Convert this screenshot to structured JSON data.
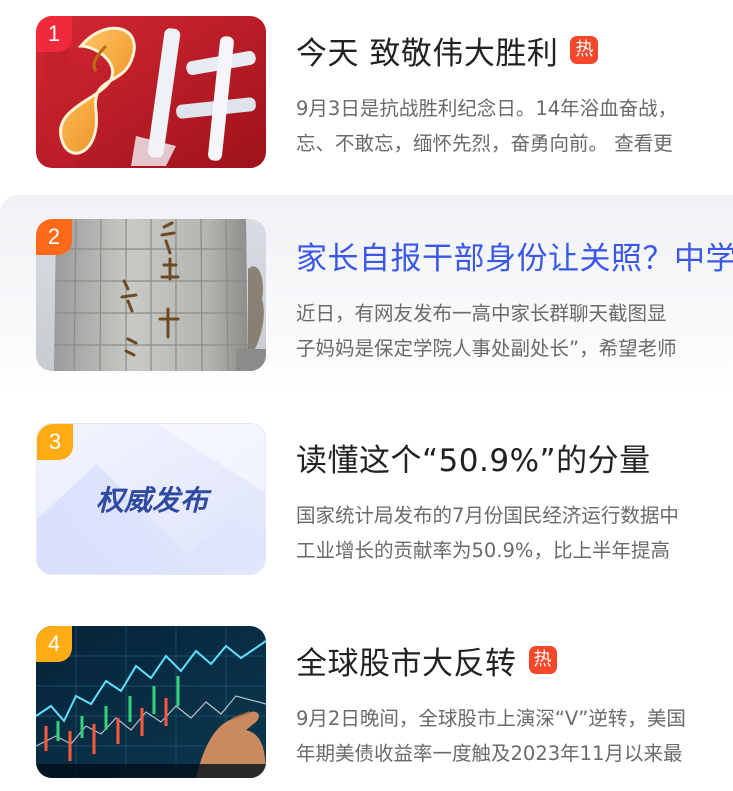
{
  "news": [
    {
      "rank": "1",
      "title": "今天 致敬伟大胜利",
      "hot": true,
      "hot_label": "热",
      "summary_line1": "9月3日是抗战胜利纪念日。14年浴血奋战，",
      "summary_line2": "忘、不敢忘，缅怀先烈，奋勇向前。 查看更",
      "rank_color": "#f0293c",
      "thumb_icon": "victory-calligraphy-image"
    },
    {
      "rank": "2",
      "title": "家长自报干部身份让关照？中学",
      "hot": false,
      "summary_line1": "近日，有网友发布一高中家长群聊天截图显",
      "summary_line2": "子妈妈是保定学院人事处副处长”，希望老师",
      "rank_color": "#ff6a1a",
      "thumb_icon": "school-gate-pillar-image"
    },
    {
      "rank": "3",
      "title": "读懂这个“50.9%”的分量",
      "hot": false,
      "summary_line1": "国家统计局发布的7月份国民经济运行数据中",
      "summary_line2": "工业增长的贡献率为50.9%，比上半年提高",
      "rank_color": "#ffab14",
      "thumb_text": "权威发布",
      "thumb_icon": "authoritative-release-banner"
    },
    {
      "rank": "4",
      "title": "全球股市大反转",
      "hot": true,
      "hot_label": "热",
      "summary_line1": "9月2日晚间，全球股市上演深“V”逆转，美国",
      "summary_line2": "年期美债收益率一度触及2023年11月以来最",
      "rank_color": "#ffab14",
      "thumb_icon": "stock-chart-screen-image"
    }
  ]
}
